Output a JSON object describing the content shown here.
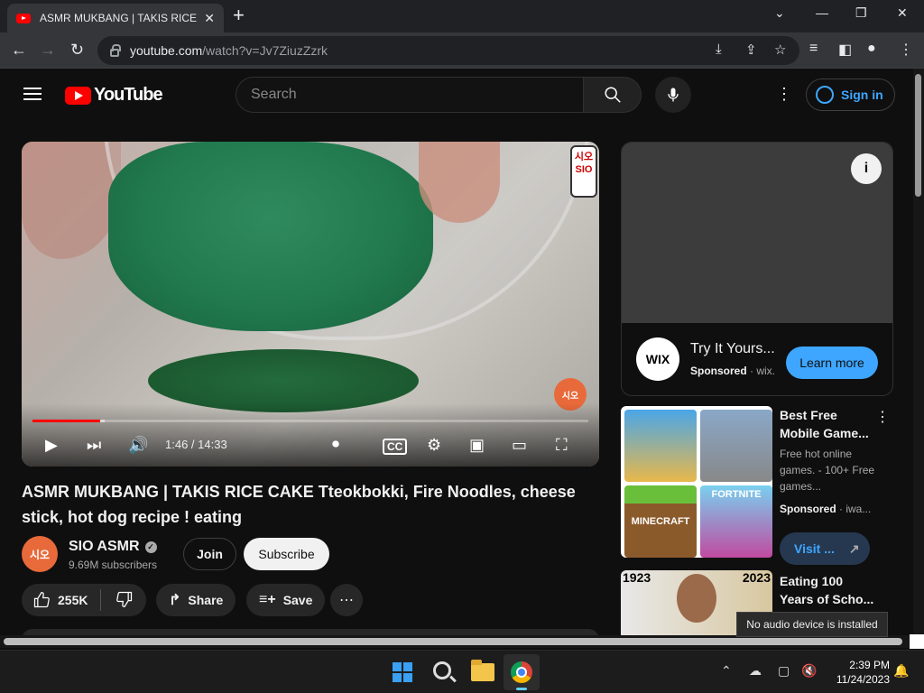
{
  "browser": {
    "tab_title": "ASMR MUKBANG | TAKIS RICE CA",
    "url_domain": "youtube.com",
    "url_path": "/watch?v=Jv7ZiuzZzrk"
  },
  "youtube": {
    "logo_text": "YouTube",
    "search_placeholder": "Search",
    "sign_in": "Sign in"
  },
  "player": {
    "time": "1:46 / 14:33",
    "progress": 0.121,
    "buffered": 0.13,
    "watermark": "시오\nSIO",
    "watermark2": "시오"
  },
  "video": {
    "title": "ASMR MUKBANG | TAKIS RICE CAKE Tteokbokki, Fire Noodles, cheese stick, hot dog recipe ! eating",
    "channel_name": "SIO ASMR",
    "channel_avatar": "시오",
    "subscribers": "9.69M subscribers",
    "join": "Join",
    "subscribe": "Subscribe",
    "likes": "255K",
    "share": "Share",
    "save": "Save"
  },
  "ad": {
    "logo": "WIX",
    "title": "Try It Yours...",
    "sponsored": "Sponsored",
    "advertiser": "wix.",
    "cta": "Learn more"
  },
  "rec1": {
    "title": "Best Free Mobile Game...",
    "desc": "Free hot online games. - 100+ Free games...",
    "sponsored": "Sponsored",
    "advertiser": "iwa...",
    "cta": "Visit ...",
    "thumb3": "MINECRAFT",
    "thumb4": "FORTNITE"
  },
  "rec2": {
    "year1": "1923",
    "year2": "2023",
    "title": "Eating 100 Years of Scho..."
  },
  "system": {
    "toast": "No audio device is installed",
    "time": "2:39 PM",
    "date": "11/24/2023"
  }
}
